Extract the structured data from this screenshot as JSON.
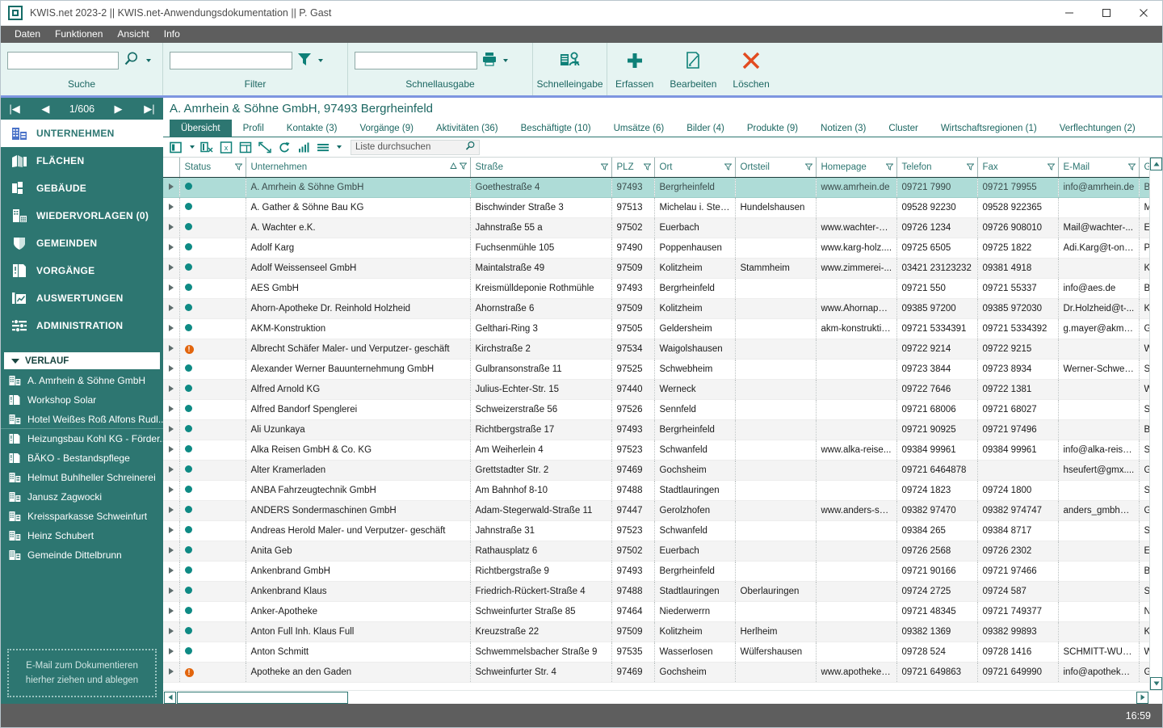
{
  "window": {
    "title": "KWIS.net 2023-2 || KWIS.net-Anwendungsdokumentation || P. Gast",
    "app_icon": "app-square-icon",
    "minimize_label": "–",
    "maximize_label": "□",
    "close_label": "✕"
  },
  "menu": {
    "items": [
      {
        "label": "Daten"
      },
      {
        "label": "Funktionen"
      },
      {
        "label": "Ansicht"
      },
      {
        "label": "Info"
      }
    ]
  },
  "ribbon": {
    "groups": [
      {
        "label": "Suche",
        "input_value": "",
        "input_placeholder": "",
        "icon": "magnifier-icon"
      },
      {
        "label": "Filter",
        "input_value": "",
        "input_placeholder": "",
        "icon": "funnel-icon"
      },
      {
        "label": "Schnellausgabe",
        "input_value": "",
        "input_placeholder": "",
        "icon": "printer-icon"
      }
    ],
    "buttons": [
      {
        "label": "Schnelleingabe",
        "icon": "quick-entry-icon"
      },
      {
        "label": "Erfassen",
        "icon": "plus-icon"
      },
      {
        "label": "Bearbeiten",
        "icon": "edit-pencil-icon"
      },
      {
        "label": "Löschen",
        "icon": "x-cross-icon"
      }
    ]
  },
  "sidebar": {
    "pager": {
      "first_label": "|◀",
      "prev_label": "◀",
      "position": "1/606",
      "next_label": "▶",
      "last_label": "▶|"
    },
    "nav": [
      {
        "label": "UNTERNEHMEN",
        "icon": "company-icon",
        "active": true
      },
      {
        "label": "FLÄCHEN",
        "icon": "areas-icon",
        "active": false
      },
      {
        "label": "GEBÄUDE",
        "icon": "building-icon",
        "active": false
      },
      {
        "label": "WIEDERVORLAGEN (0)",
        "icon": "resubmission-icon",
        "active": false
      },
      {
        "label": "GEMEINDEN",
        "icon": "shield-icon",
        "active": false
      },
      {
        "label": "VORGÄNGE",
        "icon": "process-icon",
        "active": false
      },
      {
        "label": "AUSWERTUNGEN",
        "icon": "chart-icon",
        "active": false
      },
      {
        "label": "ADMINISTRATION",
        "icon": "sliders-icon",
        "active": false
      }
    ],
    "history": {
      "title": "VERLAUF",
      "caret": "chevron-down-icon",
      "items": [
        {
          "label": "A. Amrhein & Söhne GmbH",
          "icon": "company-icon"
        },
        {
          "label": "Workshop Solar",
          "icon": "process-icon"
        },
        {
          "label": "Hotel Weißes Roß Alfons Rudl...",
          "icon": "company-icon"
        },
        {
          "label": "Heizungsbau Kohl KG - Förder...",
          "icon": "process-icon"
        },
        {
          "label": "BÄKO - Bestandspflege",
          "icon": "process-icon"
        },
        {
          "label": "Helmut Buhlheller Schreinerei",
          "icon": "company-icon"
        },
        {
          "label": "Janusz Zagwocki",
          "icon": "company-icon"
        },
        {
          "label": "Kreissparkasse Schweinfurt",
          "icon": "company-icon"
        },
        {
          "label": "Heinz Schubert",
          "icon": "company-icon"
        },
        {
          "label": "Gemeinde Dittelbrunn",
          "icon": "company-icon"
        }
      ]
    },
    "dropzone": {
      "line1": "E-Mail  zum Dokumentieren",
      "line2": "hierher ziehen und ablegen"
    }
  },
  "record": {
    "title": "A. Amrhein & Söhne GmbH, 97493 Bergrheinfeld",
    "tabs": [
      {
        "label": "Übersicht",
        "active": true
      },
      {
        "label": "Profil",
        "active": false
      },
      {
        "label": "Kontakte (3)",
        "active": false
      },
      {
        "label": "Vorgänge (9)",
        "active": false
      },
      {
        "label": "Aktivitäten (36)",
        "active": false
      },
      {
        "label": "Beschäftigte (10)",
        "active": false
      },
      {
        "label": "Umsätze (6)",
        "active": false
      },
      {
        "label": "Bilder (4)",
        "active": false
      },
      {
        "label": "Produkte (9)",
        "active": false
      },
      {
        "label": "Notizen (3)",
        "active": false
      },
      {
        "label": "Cluster",
        "active": false
      },
      {
        "label": "Wirtschaftsregionen (1)",
        "active": false
      },
      {
        "label": "Verflechtungen (2)",
        "active": false
      }
    ]
  },
  "gridbar": {
    "icons": [
      "columns-icon",
      "columns-caret-icon",
      "remove-column-icon",
      "export-excel-icon",
      "table-layout-icon",
      "expand-icon",
      "refresh-icon",
      "statistics-icon",
      "menu-lines-icon",
      "menu-caret-icon"
    ],
    "search_placeholder": "Liste durchsuchen",
    "search_value": "",
    "search_icon": "magnifier-icon"
  },
  "table": {
    "columns": [
      {
        "key": "expander",
        "label": ""
      },
      {
        "key": "status",
        "label": "Status",
        "filter": true
      },
      {
        "key": "unternehmen",
        "label": "Unternehmen",
        "filter": true,
        "sorted": "asc"
      },
      {
        "key": "strasse",
        "label": "Straße",
        "filter": true
      },
      {
        "key": "plz",
        "label": "PLZ",
        "filter": true
      },
      {
        "key": "ort",
        "label": "Ort",
        "filter": true
      },
      {
        "key": "ortsteil",
        "label": "Ortsteil",
        "filter": true
      },
      {
        "key": "homepage",
        "label": "Homepage",
        "filter": true
      },
      {
        "key": "telefon",
        "label": "Telefon",
        "filter": true
      },
      {
        "key": "fax",
        "label": "Fax",
        "filter": true
      },
      {
        "key": "email",
        "label": "E-Mail",
        "filter": true
      },
      {
        "key": "gemeinde",
        "label": "G",
        "filter": false
      }
    ],
    "rows": [
      {
        "status": "ok",
        "unternehmen": "A. Amrhein & Söhne GmbH",
        "strasse": "Goethestraße 4",
        "plz": "97493",
        "ort": "Bergrheinfeld",
        "ortsteil": "",
        "homepage": "www.amrhein.de",
        "telefon": "09721 7990",
        "fax": "09721 79955",
        "email": "info@amrhein.de",
        "gemeinde": "B",
        "selected": true
      },
      {
        "status": "ok",
        "unternehmen": "A. Gather & Söhne Bau KG",
        "strasse": "Bischwinder Straße 3",
        "plz": "97513",
        "ort": "Michelau i. Steig...",
        "ortsteil": "Hundelshausen",
        "homepage": "",
        "telefon": "09528 92230",
        "fax": "09528 922365",
        "email": "",
        "gemeinde": "M"
      },
      {
        "status": "ok",
        "unternehmen": "A. Wachter e.K.",
        "strasse": "Jahnstraße 55 a",
        "plz": "97502",
        "ort": "Euerbach",
        "ortsteil": "",
        "homepage": "www.wachter-m...",
        "telefon": "09726 1234",
        "fax": "09726 908010",
        "email": "Mail@wachter-...",
        "gemeinde": "E"
      },
      {
        "status": "ok",
        "unternehmen": "Adolf Karg",
        "strasse": "Fuchsenmühle 105",
        "plz": "97490",
        "ort": "Poppenhausen",
        "ortsteil": "",
        "homepage": "www.karg-holz....",
        "telefon": "09725 6505",
        "fax": "09725 1822",
        "email": "Adi.Karg@t-onli...",
        "gemeinde": "P"
      },
      {
        "status": "ok",
        "unternehmen": "Adolf Weissenseel GmbH",
        "strasse": "Maintalstraße 49",
        "plz": "97509",
        "ort": "Kolitzheim",
        "ortsteil": "Stammheim",
        "homepage": "www.zimmerei-...",
        "telefon": "03421 23123232",
        "fax": "09381 4918",
        "email": "",
        "gemeinde": "K"
      },
      {
        "status": "ok",
        "unternehmen": "AES GmbH",
        "strasse": "Kreismülldeponie Rothmühle",
        "plz": "97493",
        "ort": "Bergrheinfeld",
        "ortsteil": "",
        "homepage": "",
        "telefon": "09721 550",
        "fax": "09721 55337",
        "email": "info@aes.de",
        "gemeinde": "B"
      },
      {
        "status": "ok",
        "unternehmen": "Ahorn-Apotheke Dr. Reinhold Holzheid",
        "strasse": "Ahornstraße 6",
        "plz": "97509",
        "ort": "Kolitzheim",
        "ortsteil": "",
        "homepage": "www.Ahornapot...",
        "telefon": "09385 97200",
        "fax": "09385 972030",
        "email": "Dr.Holzheid@t-...",
        "gemeinde": "K"
      },
      {
        "status": "ok",
        "unternehmen": "AKM-Konstruktion",
        "strasse": "Gelthari-Ring 3",
        "plz": "97505",
        "ort": "Geldersheim",
        "ortsteil": "",
        "homepage": "akm-konstruktio...",
        "telefon": "09721 5334391",
        "fax": "09721 5334392",
        "email": "g.mayer@akm-...",
        "gemeinde": "G"
      },
      {
        "status": "warn",
        "unternehmen": "Albrecht Schäfer Maler- und Verputzer- geschäft",
        "strasse": "Kirchstraße 2",
        "plz": "97534",
        "ort": "Waigolshausen",
        "ortsteil": "",
        "homepage": "",
        "telefon": "09722 9214",
        "fax": "09722 9215",
        "email": "",
        "gemeinde": "W"
      },
      {
        "status": "ok",
        "unternehmen": "Alexander Werner Bauunternehmung GmbH",
        "strasse": "Gulbransonstraße 11",
        "plz": "97525",
        "ort": "Schwebheim",
        "ortsteil": "",
        "homepage": "",
        "telefon": "09723 3844",
        "fax": "09723 8934",
        "email": "Werner-Schweb...",
        "gemeinde": "S"
      },
      {
        "status": "ok",
        "unternehmen": "Alfred Arnold KG",
        "strasse": "Julius-Echter-Str. 15",
        "plz": "97440",
        "ort": "Werneck",
        "ortsteil": "",
        "homepage": "",
        "telefon": "09722 7646",
        "fax": "09722 1381",
        "email": "",
        "gemeinde": "W"
      },
      {
        "status": "ok",
        "unternehmen": "Alfred Bandorf Spenglerei",
        "strasse": "Schweizerstraße 56",
        "plz": "97526",
        "ort": "Sennfeld",
        "ortsteil": "",
        "homepage": "",
        "telefon": "09721 68006",
        "fax": "09721 68027",
        "email": "",
        "gemeinde": "S"
      },
      {
        "status": "ok",
        "unternehmen": "Ali Uzunkaya",
        "strasse": "Richtbergstraße 17",
        "plz": "97493",
        "ort": "Bergrheinfeld",
        "ortsteil": "",
        "homepage": "",
        "telefon": "09721 90925",
        "fax": "09721 97496",
        "email": "",
        "gemeinde": "B"
      },
      {
        "status": "ok",
        "unternehmen": "Alka Reisen GmbH & Co. KG",
        "strasse": "Am Weiherlein 4",
        "plz": "97523",
        "ort": "Schwanfeld",
        "ortsteil": "",
        "homepage": "www.alka-reise...",
        "telefon": "09384 99961",
        "fax": "09384 99961",
        "email": "info@alka-reise...",
        "gemeinde": "S"
      },
      {
        "status": "ok",
        "unternehmen": "Alter Kramerladen",
        "strasse": "Grettstadter Str. 2",
        "plz": "97469",
        "ort": "Gochsheim",
        "ortsteil": "",
        "homepage": "",
        "telefon": "09721 6464878",
        "fax": "",
        "email": "hseufert@gmx....",
        "gemeinde": "G"
      },
      {
        "status": "ok",
        "unternehmen": "ANBA Fahrzeugtechnik GmbH",
        "strasse": "Am Bahnhof 8-10",
        "plz": "97488",
        "ort": "Stadtlauringen",
        "ortsteil": "",
        "homepage": "",
        "telefon": "09724 1823",
        "fax": "09724 1800",
        "email": "",
        "gemeinde": "S"
      },
      {
        "status": "ok",
        "unternehmen": "ANDERS Sondermaschinen GmbH",
        "strasse": "Adam-Stegerwald-Straße 11",
        "plz": "97447",
        "ort": "Gerolzhofen",
        "ortsteil": "",
        "homepage": "www.anders-so...",
        "telefon": "09382 97470",
        "fax": "09382 974747",
        "email": "anders_gmbh@...",
        "gemeinde": "G"
      },
      {
        "status": "ok",
        "unternehmen": "Andreas Herold Maler- und Verputzer- geschäft",
        "strasse": "Jahnstraße 31",
        "plz": "97523",
        "ort": "Schwanfeld",
        "ortsteil": "",
        "homepage": "",
        "telefon": "09384 265",
        "fax": "09384 8717",
        "email": "",
        "gemeinde": "S"
      },
      {
        "status": "ok",
        "unternehmen": "Anita Geb",
        "strasse": "Rathausplatz 6",
        "plz": "97502",
        "ort": "Euerbach",
        "ortsteil": "",
        "homepage": "",
        "telefon": "09726 2568",
        "fax": "09726 2302",
        "email": "",
        "gemeinde": "E"
      },
      {
        "status": "ok",
        "unternehmen": "Ankenbrand GmbH",
        "strasse": "Richtbergstraße 9",
        "plz": "97493",
        "ort": "Bergrheinfeld",
        "ortsteil": "",
        "homepage": "",
        "telefon": "09721 90166",
        "fax": "09721 97466",
        "email": "",
        "gemeinde": "B"
      },
      {
        "status": "ok",
        "unternehmen": "Ankenbrand Klaus",
        "strasse": "Friedrich-Rückert-Straße 4",
        "plz": "97488",
        "ort": "Stadtlauringen",
        "ortsteil": "Oberlauringen",
        "homepage": "",
        "telefon": "09724 2725",
        "fax": "09724 587",
        "email": "",
        "gemeinde": "S"
      },
      {
        "status": "ok",
        "unternehmen": "Anker-Apotheke",
        "strasse": "Schweinfurter Straße 85",
        "plz": "97464",
        "ort": "Niederwerrn",
        "ortsteil": "",
        "homepage": "",
        "telefon": "09721 48345",
        "fax": "09721 749377",
        "email": "",
        "gemeinde": "N"
      },
      {
        "status": "ok",
        "unternehmen": "Anton Full Inh. Klaus Full",
        "strasse": "Kreuzstraße 22",
        "plz": "97509",
        "ort": "Kolitzheim",
        "ortsteil": "Herlheim",
        "homepage": "",
        "telefon": "09382 1369",
        "fax": "09382 99893",
        "email": "",
        "gemeinde": "K"
      },
      {
        "status": "ok",
        "unternehmen": "Anton Schmitt",
        "strasse": "Schwemmelsbacher Straße 9",
        "plz": "97535",
        "ort": "Wasserlosen",
        "ortsteil": "Wülfershausen",
        "homepage": "",
        "telefon": "09728 524",
        "fax": "09728 1416",
        "email": "SCHMITT-WUE...",
        "gemeinde": "W"
      },
      {
        "status": "warn",
        "unternehmen": "Apotheke an den Gaden",
        "strasse": "Schweinfurter Str. 4",
        "plz": "97469",
        "ort": "Gochsheim",
        "ortsteil": "",
        "homepage": "www.apotheke-...",
        "telefon": "09721 649863",
        "fax": "09721 649990",
        "email": "info@apotheke-...",
        "gemeinde": "G"
      }
    ]
  },
  "scrollbars": {
    "v_up": "▲",
    "v_down": "▼",
    "h_left": "◀",
    "h_right": "▶"
  },
  "statusbar": {
    "time": "16:59"
  },
  "colors": {
    "accent": "#2d7671",
    "accent_dark": "#1b6661",
    "ribbon_bg": "#e6f4f2",
    "menu_bg": "#5e5e5e",
    "selection": "#aedcd7",
    "status_ok": "#0e8a84",
    "status_warn": "#e2650d",
    "ribbon_underline": "#7d95e0"
  }
}
